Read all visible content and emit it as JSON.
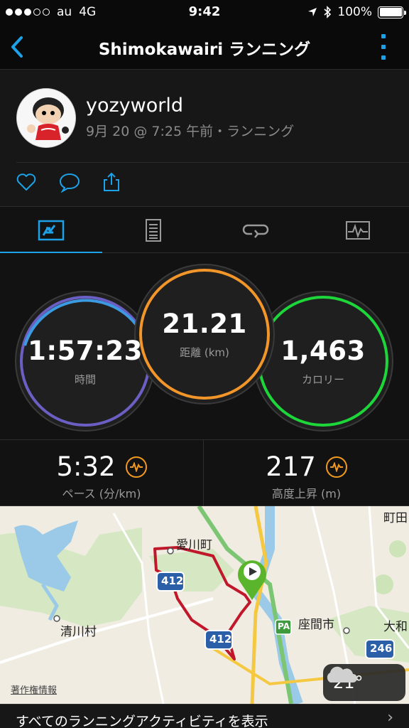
{
  "status": {
    "carrier": "au",
    "network": "4G",
    "time": "9:42",
    "battery": "100%"
  },
  "nav": {
    "title": "Shimokawairi ランニング"
  },
  "activity": {
    "username": "yozyworld",
    "meta": "9月 20 @ 7:25 午前・ランニング"
  },
  "tabs": [
    {
      "icon": "summary-icon",
      "active": true
    },
    {
      "icon": "details-icon",
      "active": false
    },
    {
      "icon": "laps-icon",
      "active": false
    },
    {
      "icon": "chart-icon",
      "active": false
    }
  ],
  "stats": {
    "time": {
      "value": "1:57:23",
      "label": "時間"
    },
    "distance": {
      "value": "21.21",
      "label": "距離 (km)"
    },
    "calories": {
      "value": "1,463",
      "label": "カロリー"
    },
    "pace": {
      "value": "5:32",
      "label": "ペース (分/km)"
    },
    "elevation": {
      "value": "217",
      "label": "高度上昇 (m)"
    }
  },
  "map": {
    "labels": {
      "aikawa": "愛川町",
      "kiyokawa": "清川村",
      "zama": "座間市",
      "yamato": "大和",
      "machida": "町田",
      "route412a": "412",
      "route412b": "412",
      "route246": "246",
      "pa": "PA"
    },
    "credit": "著作権情報"
  },
  "weather": {
    "temp": "21°"
  },
  "footer": {
    "link": "すべてのランニングアクティビティを表示",
    "chevron": "›"
  },
  "colors": {
    "accent": "#1da1e8",
    "time_ring": "#3c9be0",
    "distance_ring": "#f2962a",
    "calories_ring": "#1dd63a",
    "route": "#c0182a",
    "marker": "#5ab52d"
  }
}
